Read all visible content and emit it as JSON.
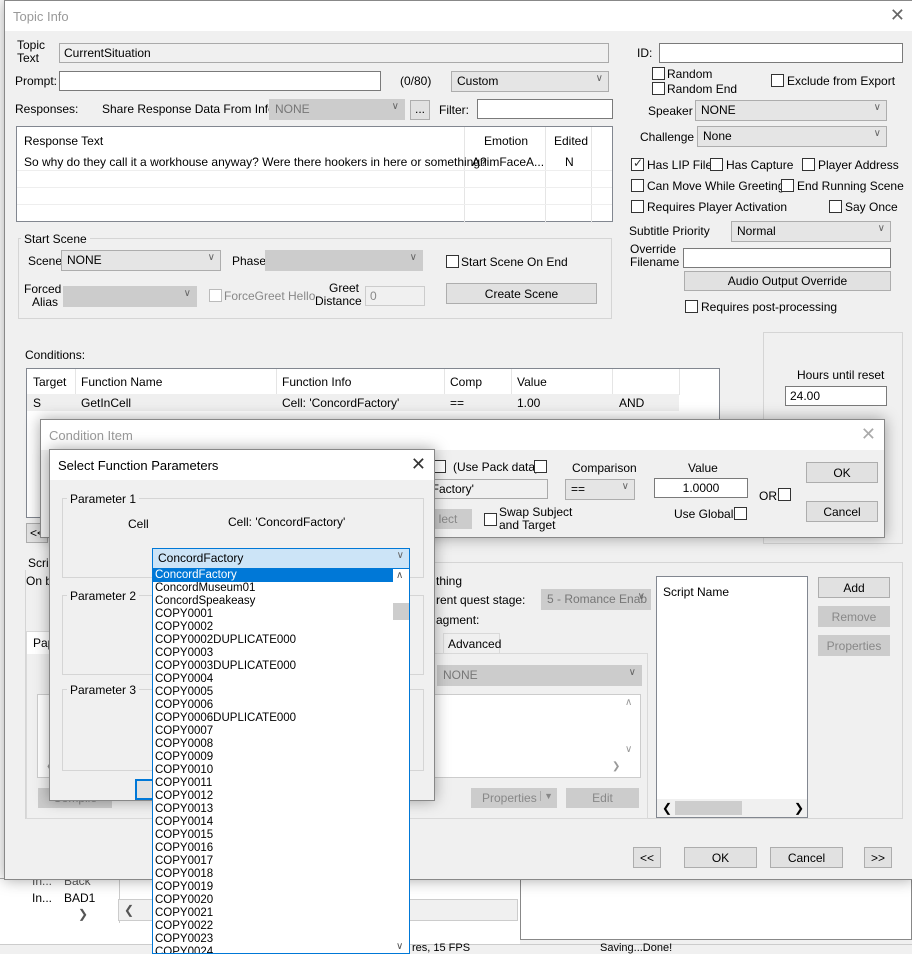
{
  "background": {
    "left_fragments": [
      "Back",
      "BAD1"
    ],
    "left_fragment_prefix": "In...",
    "status_left": "res, 15 FPS",
    "status_right": "Saving...Done!"
  },
  "topic_info": {
    "title": "Topic Info",
    "topic_text_label": "Topic Text",
    "topic_text_value": "CurrentSituation",
    "prompt_label": "Prompt:",
    "prompt_value": "",
    "prompt_counter": "(0/80)",
    "prompt_type": "Custom",
    "id_label": "ID:",
    "id_value": "",
    "random_label": "Random",
    "random_end_label": "Random End",
    "exclude_export_label": "Exclude from Export",
    "speaker_label": "Speaker",
    "speaker_value": "NONE",
    "challenge_label": "Challenge",
    "challenge_value": "None",
    "responses_label": "Responses:",
    "share_label": "Share Response Data From Info:",
    "share_value": "NONE",
    "ellipsis": "...",
    "filter_label": "Filter:",
    "filter_value": "",
    "responses_table": {
      "columns": [
        "Response Text",
        "Emotion",
        "Edited"
      ],
      "rows": [
        {
          "text": "So why do they call it a workhouse anyway? Were there hookers in here or something?",
          "emotion": "AnimFaceA...",
          "edited": "N"
        }
      ]
    },
    "flags": {
      "has_lip": {
        "label": "Has LIP File",
        "checked": true
      },
      "has_capture": {
        "label": "Has Capture",
        "checked": false
      },
      "player_address": {
        "label": "Player Address",
        "checked": false
      },
      "can_move": {
        "label": "Can Move While Greeting",
        "checked": false
      },
      "end_running": {
        "label": "End Running Scene",
        "checked": false
      },
      "requires_activation": {
        "label": "Requires Player Activation",
        "checked": false
      },
      "say_once": {
        "label": "Say Once",
        "checked": false
      }
    },
    "subtitle_priority_label": "Subtitle Priority",
    "subtitle_priority_value": "Normal",
    "override_filename_label": "Override Filename",
    "override_filename_value": "",
    "audio_override_button": "Audio Output Override",
    "post_processing_label": "Requires post-processing",
    "start_scene": {
      "group_label": "Start Scene",
      "scene_label": "Scene",
      "scene_value": "NONE",
      "phase_label": "Phase",
      "start_on_end_label": "Start Scene On End",
      "forced_alias_label": "Forced Alias",
      "forcegreet_label": "ForceGreet Hello",
      "greet_distance_label": "Greet Distance",
      "greet_distance_value": "0",
      "create_scene_button": "Create Scene"
    },
    "conditions_label": "Conditions:",
    "conditions_table": {
      "columns": [
        "Target",
        "Function Name",
        "Function Info",
        "Comp",
        "Value",
        ""
      ],
      "rows": [
        {
          "target": "S",
          "function": "GetInCell",
          "info": "Cell: 'ConcordFactory'",
          "comp": "==",
          "value": "1.00",
          "andor": "AND"
        }
      ]
    },
    "hours_label": "Hours until reset",
    "hours_value": "24.00",
    "prev_small": "<<",
    "script_group_label": "Script",
    "on_begin_fragment": "On b",
    "something_fragment": "thing",
    "quest_stage_fragment": "rent quest stage:",
    "quest_stage_value": "5 - Romance Enab",
    "fragment_label": "agment:",
    "tab_papyrus": "Pap",
    "tab_advanced": "Advanced",
    "fragment_select": "NONE",
    "properties_button": "Properties",
    "edit_button": "Edit",
    "compile_button": "Compile",
    "script_name_header": "Script Name",
    "add_button": "Add",
    "remove_button": "Remove",
    "script_properties_button": "Properties",
    "nav_prev": "<<",
    "ok_button": "OK",
    "cancel_button": "Cancel",
    "nav_next": ">>"
  },
  "condition_item": {
    "title": "Condition Item",
    "use_pack_label": "(Use Pack data)",
    "function_info_fragment": "lFactory'",
    "select_fragment": "lect",
    "swap_label": "Swap Subject and Target",
    "comparison_label": "Comparison",
    "comparison_value": "==",
    "value_label": "Value",
    "value_value": "1.0000",
    "use_global_label": "Use Global",
    "or_label": "OR",
    "ok_button": "OK",
    "cancel_button": "Cancel"
  },
  "select_params": {
    "title": "Select Function Parameters",
    "param1_label": "Parameter 1",
    "param1_type": "Cell",
    "param1_info": "Cell: 'ConcordFactory'",
    "param1_value": "ConcordFactory",
    "param2_label": "Parameter 2",
    "param3_label": "Parameter 3",
    "dropdown_items": [
      "ConcordFactory",
      "ConcordMuseum01",
      "ConcordSpeakeasy",
      "COPY0001",
      "COPY0002",
      "COPY0002DUPLICATE000",
      "COPY0003",
      "COPY0003DUPLICATE000",
      "COPY0004",
      "COPY0005",
      "COPY0006",
      "COPY0006DUPLICATE000",
      "COPY0007",
      "COPY0008",
      "COPY0009",
      "COPY0010",
      "COPY0011",
      "COPY0012",
      "COPY0013",
      "COPY0014",
      "COPY0015",
      "COPY0016",
      "COPY0017",
      "COPY0018",
      "COPY0019",
      "COPY0020",
      "COPY0021",
      "COPY0022",
      "COPY0023",
      "COPY0024"
    ],
    "selected_index": 0
  }
}
